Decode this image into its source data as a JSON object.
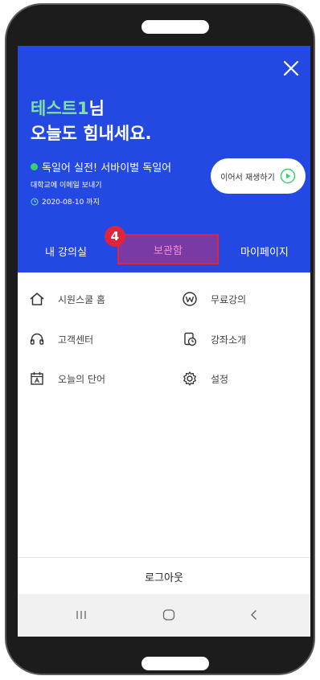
{
  "header": {
    "user_name": "테스트1",
    "user_suffix": "님",
    "greeting": "오늘도 힘내세요.",
    "course_title": "독일어 실전! 서바이벌 독일어",
    "course_subtitle": "대학교에 이메일 보내기",
    "expiry_date": "2020-08-10 까지",
    "resume_label": "이어서 재생하기"
  },
  "tabs": [
    {
      "label": "내 강의실"
    },
    {
      "label": "보관함"
    },
    {
      "label": "마이페이지"
    }
  ],
  "step_badge": "4",
  "menu": [
    {
      "label": "시원스쿨 홈",
      "icon": "home-icon"
    },
    {
      "label": "무료강의",
      "icon": "free-lecture-icon"
    },
    {
      "label": "고객센터",
      "icon": "headset-icon"
    },
    {
      "label": "강좌소개",
      "icon": "course-intro-icon"
    },
    {
      "label": "오늘의 단어",
      "icon": "calendar-word-icon"
    },
    {
      "label": "설정",
      "icon": "gear-icon"
    }
  ],
  "logout_label": "로그아웃",
  "colors": {
    "header_bg": "#2448e2",
    "accent_green": "#7fe2a2",
    "highlight_tab": "#7a3aa6",
    "highlight_border": "#e0243c"
  }
}
